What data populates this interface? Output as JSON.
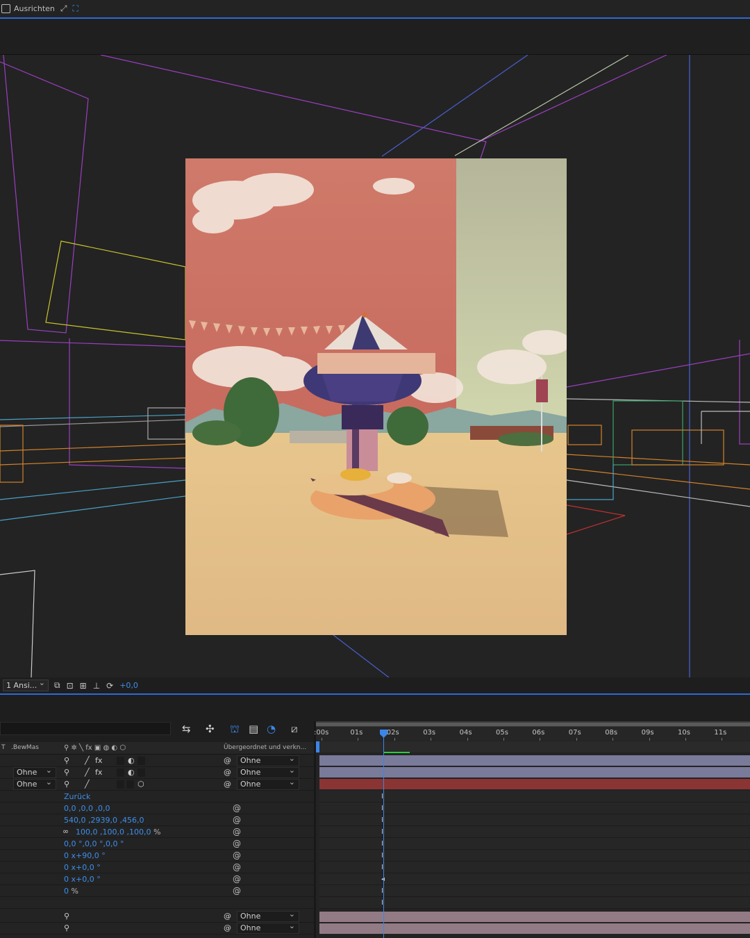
{
  "toolbar": {
    "align_label": "Ausrichten",
    "icons": [
      "checkbox-icon",
      "snap-icon",
      "grid-snap-icon"
    ]
  },
  "viewer_footer": {
    "view_select": "1 Ansi...",
    "exposure_value": "+0,0",
    "icons": [
      "view-options-icon",
      "fast-preview-icon",
      "3d-view-icon",
      "layout-icon",
      "reset-exposure-icon"
    ]
  },
  "timeline": {
    "columns": {
      "trkmat": "T",
      "bewmas": ".BewMas",
      "parent": "Übergeordnet und verkn..."
    },
    "ruler_ticks": [
      ":00s",
      "01s",
      "02s",
      "03s",
      "04s",
      "05s",
      "06s",
      "07s",
      "08s",
      "09s",
      "10s",
      "11s"
    ],
    "layers": [
      {
        "mode": "",
        "parent": "Ohne"
      },
      {
        "mode": "Ohne",
        "parent": "Ohne"
      },
      {
        "mode": "Ohne",
        "parent": "Ohne"
      }
    ],
    "properties": [
      {
        "value": "Zurück"
      },
      {
        "value": "0,0 ,0,0 ,0,0"
      },
      {
        "value": "540,0 ,2939,0 ,456,0"
      },
      {
        "value": "100,0 ,100,0 ,100,0",
        "suffix": " %"
      },
      {
        "value": "0,0 °,0,0 °,0,0 °"
      },
      {
        "value": "0 x+90,0 °"
      },
      {
        "value": "0 x+0,0 °"
      },
      {
        "value": "0 x+0,0 °"
      },
      {
        "value": "0",
        "suffix": " %"
      }
    ],
    "bottom_layers": [
      {
        "parent": "Ohne"
      },
      {
        "parent": "Ohne"
      }
    ],
    "track_colors": {
      "layer1": "#7a7a9a",
      "layer2": "#7a7a9a",
      "layer3": "#8a3434",
      "bottom": "#927b85"
    }
  }
}
